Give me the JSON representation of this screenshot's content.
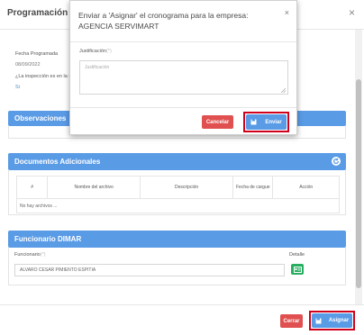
{
  "background_modal": {
    "title": "Programación de I",
    "close_glyph": "×",
    "fields": {
      "fecha_label": "Fecha Programada",
      "fecha_value": "08/09/2022",
      "inspeccion_label": "¿La inspección es en la Se",
      "inspeccion_value": "Si"
    },
    "observaciones": {
      "title": "Observaciones"
    },
    "documentos": {
      "title": "Documentos Adicionales",
      "columns": [
        "#",
        "Nombre del archivo",
        "Descripción",
        "Fecha de cargue",
        "Acción"
      ],
      "empty_text": "No hay archivos ..."
    },
    "funcionario": {
      "title": "Funcionario DIMAR",
      "label": "Funcionario",
      "required_mark": "(*)",
      "value": "ALVARO CESAR PIMIENTO ESPITIA",
      "detail_label": "Detalle"
    },
    "footer": {
      "close_label": "Cerrar",
      "assign_label": "Asignar"
    }
  },
  "dialog": {
    "title": "Enviar a 'Asignar' el cronograma para la empresa: AGENCIA SERVIMART",
    "close_glyph": "×",
    "justificacion_label": "Justificación",
    "required_mark": "(*)",
    "justificacion_placeholder": "Justificación",
    "cancel_label": "Cancelar",
    "send_label": "Enviar"
  },
  "colors": {
    "primary": "#5a9be6",
    "danger": "#e05050",
    "success": "#27ae60",
    "highlight": "#d0021b"
  },
  "icons": [
    "close-icon",
    "refresh-icon",
    "id-card-icon",
    "save-icon",
    "resize-icon"
  ]
}
